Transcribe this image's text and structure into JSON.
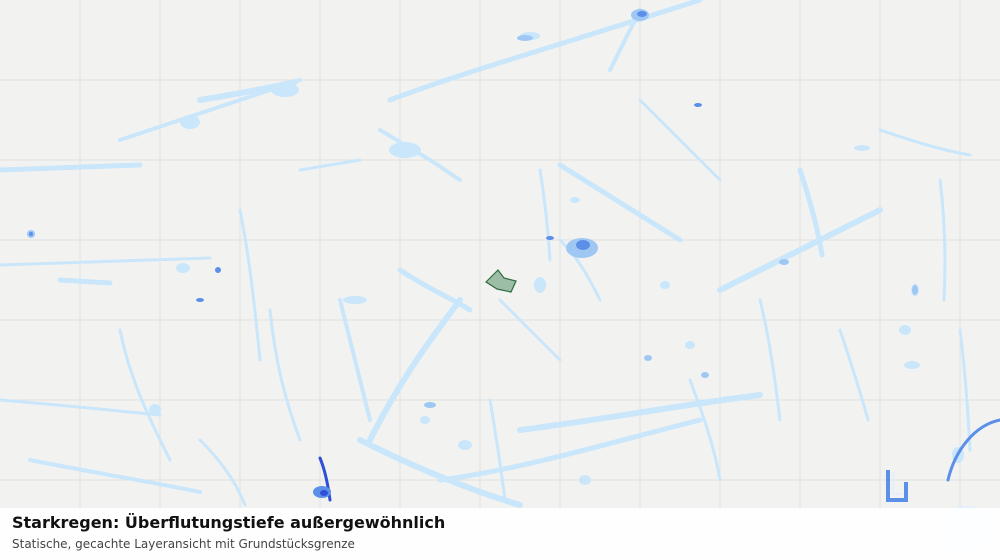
{
  "map": {
    "layer": "Starkregen: Überflutungstiefe außergewöhnlich",
    "colors": {
      "background": "#f2f3f1",
      "grid": "#e0e2df",
      "depth_shallow": "#c9e6fb",
      "depth_medium": "#9fc7f3",
      "depth_high": "#5b8fe8",
      "depth_extreme": "#2f4fd9",
      "parcel_fill": "#8fb39a",
      "parcel_stroke": "#2e6b3f"
    }
  },
  "caption": {
    "title": "Starkregen: Überflutungstiefe außergewöhnlich",
    "subtitle": "Statische, gecachte Layeransicht mit Grundstücksgrenze"
  }
}
